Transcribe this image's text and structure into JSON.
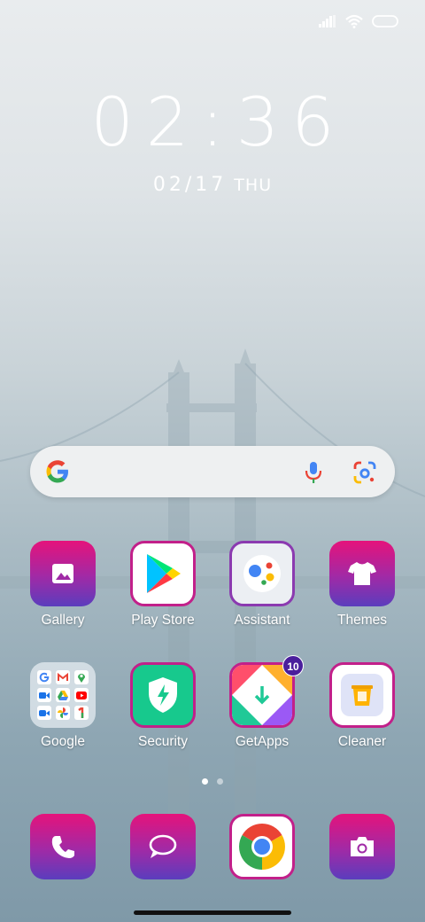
{
  "status": {
    "icons": [
      "signal-icon",
      "wifi-icon",
      "battery-icon"
    ]
  },
  "clock": {
    "time": "02:36",
    "date": "02/17",
    "weekday": "THU"
  },
  "search": {
    "icons": [
      "google-g-icon",
      "mic-icon",
      "lens-icon"
    ]
  },
  "apps": [
    {
      "label": "Gallery",
      "icon": "image-icon"
    },
    {
      "label": "Play Store",
      "icon": "play-store-icon"
    },
    {
      "label": "Assistant",
      "icon": "assistant-icon"
    },
    {
      "label": "Themes",
      "icon": "tshirt-icon"
    },
    {
      "label": "Google",
      "icon": "folder-icon"
    },
    {
      "label": "Security",
      "icon": "shield-bolt-icon"
    },
    {
      "label": "GetApps",
      "icon": "getapps-icon",
      "badge": "10"
    },
    {
      "label": "Cleaner",
      "icon": "trash-icon"
    }
  ],
  "dock": [
    {
      "icon": "phone-icon"
    },
    {
      "icon": "messages-icon"
    },
    {
      "icon": "chrome-icon"
    },
    {
      "icon": "camera-icon"
    }
  ],
  "pages": {
    "count": 2,
    "active": 1
  },
  "colors": {
    "accent_pink": "#e5137b",
    "accent_purple": "#5b3dbd",
    "badge": "#4a1e9c"
  }
}
